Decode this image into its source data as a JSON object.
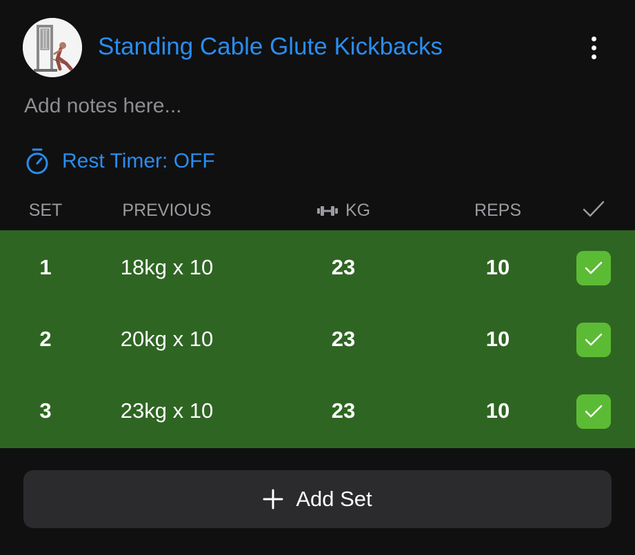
{
  "exercise": {
    "title": "Standing Cable Glute Kickbacks",
    "thumbnail_icon": "cable-machine-illustration",
    "menu_icon": "kebab-menu-icon"
  },
  "notes": {
    "placeholder": "Add notes here..."
  },
  "rest_timer": {
    "label": "Rest Timer: OFF",
    "icon": "stopwatch-icon"
  },
  "columns": {
    "set": "SET",
    "previous": "PREVIOUS",
    "weight_icon": "dumbbell-icon",
    "weight": "KG",
    "reps": "REPS",
    "done_icon": "checkmark-icon"
  },
  "sets": [
    {
      "set": "1",
      "previous": "18kg x 10",
      "weight": "23",
      "reps": "10",
      "completed": true
    },
    {
      "set": "2",
      "previous": "20kg x 10",
      "weight": "23",
      "reps": "10",
      "completed": true
    },
    {
      "set": "3",
      "previous": "23kg x 10",
      "weight": "23",
      "reps": "10",
      "completed": true
    }
  ],
  "add_set": {
    "label": "Add Set",
    "icon": "plus-icon"
  },
  "colors": {
    "accent_blue": "#2a8df0",
    "completed_row": "#2f6523",
    "checkbox_green": "#5cbb35",
    "background": "#101011",
    "button_bg": "#2b2b2e"
  }
}
